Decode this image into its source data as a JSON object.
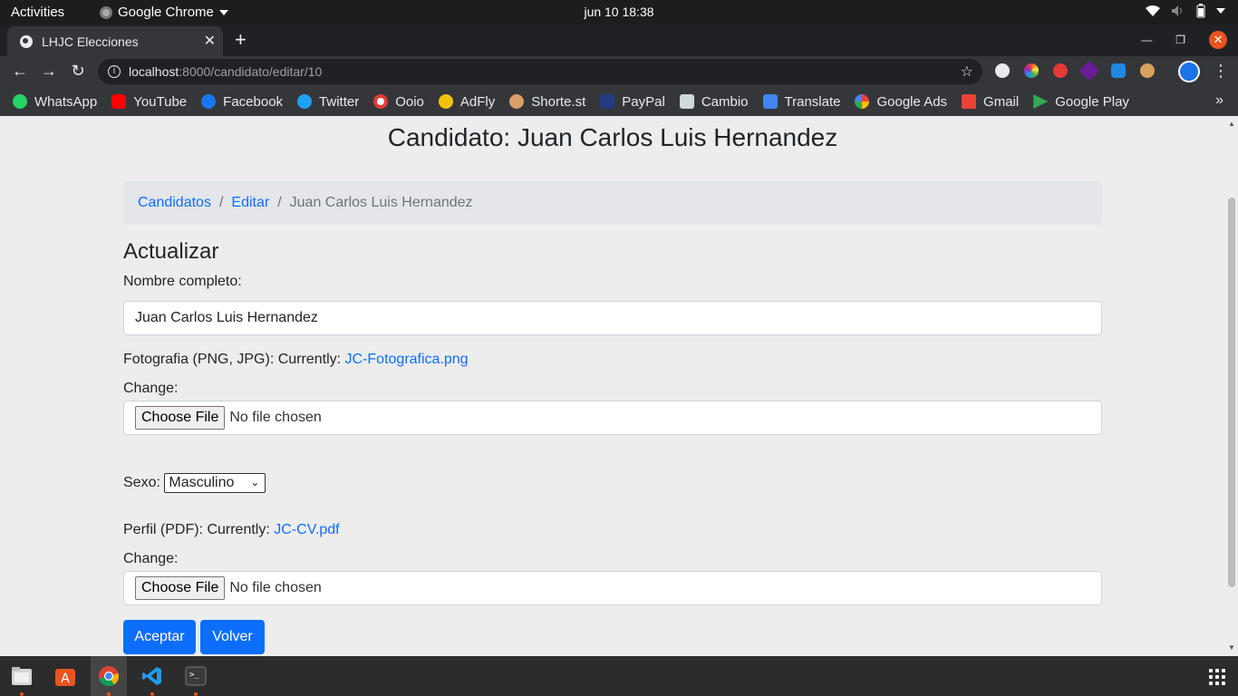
{
  "system": {
    "activities": "Activities",
    "app_name": "Google Chrome",
    "clock": "jun 10  18:38"
  },
  "browser": {
    "tab_title": "LHJC Elecciones",
    "url_host": "localhost",
    "url_path": ":8000/candidato/editar/10",
    "bookmarks": [
      {
        "label": "WhatsApp",
        "icon": "whatsapp-icon",
        "color": "#25d366"
      },
      {
        "label": "YouTube",
        "icon": "youtube-icon",
        "color": "#ff0000"
      },
      {
        "label": "Facebook",
        "icon": "facebook-icon",
        "color": "#1877f2"
      },
      {
        "label": "Twitter",
        "icon": "twitter-icon",
        "color": "#1da1f2"
      },
      {
        "label": "Ooio",
        "icon": "ooio-icon",
        "color": "#e53935"
      },
      {
        "label": "AdFly",
        "icon": "adfly-icon",
        "color": "#f4c20d"
      },
      {
        "label": "Shorte.st",
        "icon": "shortest-icon",
        "color": "#d9a066"
      },
      {
        "label": "PayPal",
        "icon": "paypal-icon",
        "color": "#253b80"
      },
      {
        "label": "Cambio",
        "icon": "cambio-icon",
        "color": "#cfd8dc"
      },
      {
        "label": "Translate",
        "icon": "translate-icon",
        "color": "#4285f4"
      },
      {
        "label": "Google Ads",
        "icon": "google-icon",
        "color": "#ffffff"
      },
      {
        "label": "Gmail",
        "icon": "gmail-icon",
        "color": "#ea4335"
      },
      {
        "label": "Google Play",
        "icon": "google-play-icon",
        "color": "#34a853"
      }
    ]
  },
  "page": {
    "title": "Candidato: Juan Carlos Luis Hernandez",
    "breadcrumb": {
      "item1": "Candidatos",
      "sep": "/",
      "item2": "Editar",
      "current": "Juan Carlos Luis Hernandez"
    },
    "section_title": "Actualizar",
    "nombre_label": "Nombre completo:",
    "nombre_value": "Juan Carlos Luis Hernandez",
    "foto_label": "Fotografia (PNG, JPG): Currently: ",
    "foto_link": "JC-Fotografica.png",
    "change_label": "Change:",
    "choose_file": "Choose File",
    "no_file": "No file chosen",
    "sexo_label": "Sexo: ",
    "sexo_value": "Masculino",
    "perfil_label": "Perfil (PDF): Currently: ",
    "perfil_link": "JC-CV.pdf",
    "aceptar": "Aceptar",
    "volver": "Volver"
  },
  "colors": {
    "primary": "#0d6efd",
    "ubuntu_orange": "#e95420"
  }
}
